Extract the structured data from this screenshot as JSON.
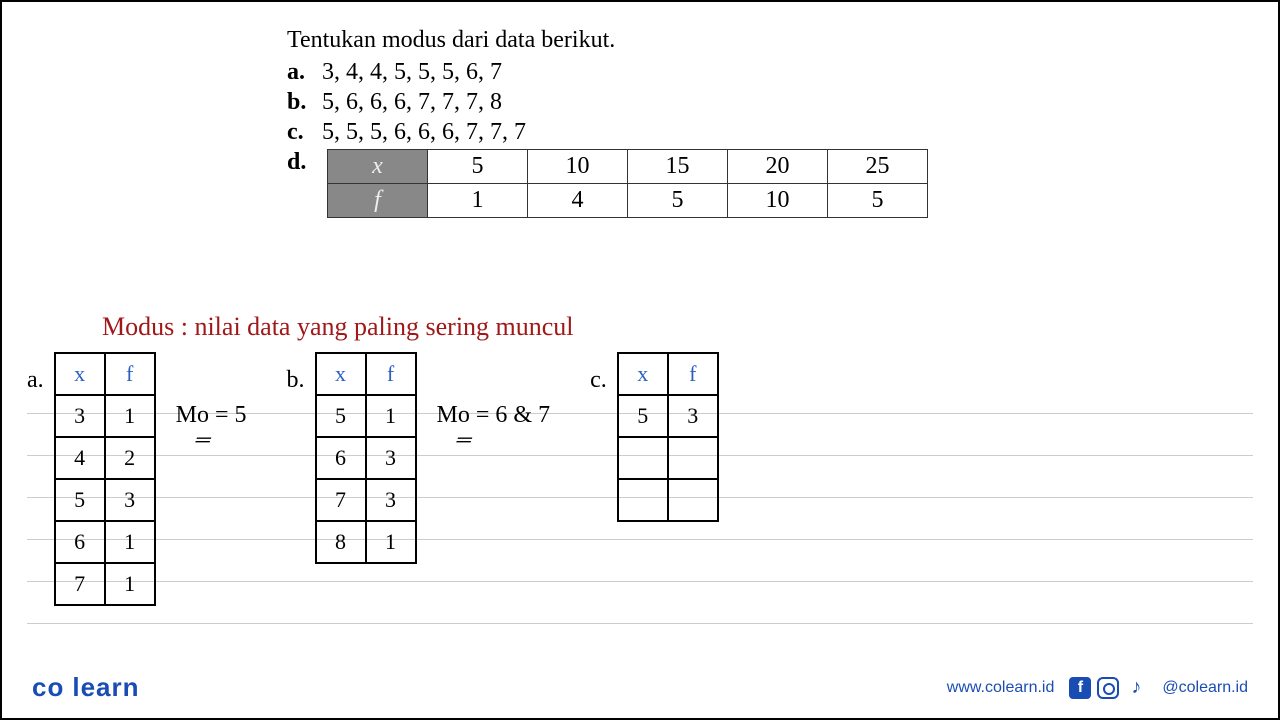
{
  "question": {
    "title": "Tentukan modus dari data berikut.",
    "items": {
      "a": {
        "label": "a.",
        "text": "3, 4, 4, 5, 5, 5, 6, 7"
      },
      "b": {
        "label": "b.",
        "text": "5, 6, 6, 6, 7, 7, 7, 8"
      },
      "c": {
        "label": "c.",
        "text": "5, 5, 5, 6, 6, 6, 7, 7, 7"
      },
      "d": {
        "label": "d."
      }
    },
    "table_d": {
      "row1_header": "x",
      "row2_header": "f",
      "cols": [
        {
          "x": "5",
          "f": "1"
        },
        {
          "x": "10",
          "f": "4"
        },
        {
          "x": "15",
          "f": "5"
        },
        {
          "x": "20",
          "f": "10"
        },
        {
          "x": "25",
          "f": "5"
        }
      ]
    }
  },
  "notes": {
    "definition": "Modus : nilai data yang paling sering muncul",
    "group_a": {
      "label": "a.",
      "header_x": "x",
      "header_f": "f",
      "rows": [
        {
          "x": "3",
          "f": "1"
        },
        {
          "x": "4",
          "f": "2"
        },
        {
          "x": "5",
          "f": "3"
        },
        {
          "x": "6",
          "f": "1"
        },
        {
          "x": "7",
          "f": "1"
        }
      ],
      "mo": "Mo = 5"
    },
    "group_b": {
      "label": "b.",
      "header_x": "x",
      "header_f": "f",
      "rows": [
        {
          "x": "5",
          "f": "1"
        },
        {
          "x": "6",
          "f": "3"
        },
        {
          "x": "7",
          "f": "3"
        },
        {
          "x": "8",
          "f": "1"
        }
      ],
      "mo": "Mo = 6 & 7"
    },
    "group_c": {
      "label": "c.",
      "header_x": "x",
      "header_f": "f",
      "rows": [
        {
          "x": "5",
          "f": "3"
        },
        {
          "x": "",
          "f": ""
        },
        {
          "x": "",
          "f": ""
        }
      ]
    }
  },
  "footer": {
    "logo": "co learn",
    "website": "www.colearn.id",
    "handle": "@colearn.id"
  }
}
